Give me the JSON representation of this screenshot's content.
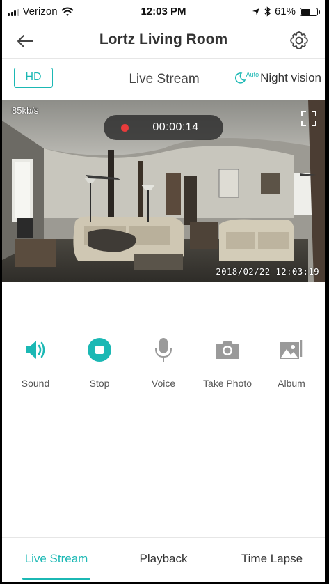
{
  "status_bar": {
    "carrier": "Verizon",
    "time": "12:03 PM",
    "battery": "61%",
    "battery_level": 0.61
  },
  "header": {
    "title": "Lortz Living Room",
    "back_icon": "arrow-left-icon",
    "settings_icon": "gear-icon"
  },
  "stream_bar": {
    "quality": "HD",
    "mode_label": "Live Stream",
    "night_auto": "Auto",
    "night_label": "Night vision"
  },
  "video": {
    "bitrate": "85kb/s",
    "recording_time": "00:00:14",
    "timestamp": "2018/02/22  12:03:19"
  },
  "controls": [
    {
      "label": "Sound",
      "icon": "speaker-icon",
      "active": true
    },
    {
      "label": "Stop",
      "icon": "stop-icon",
      "active": true
    },
    {
      "label": "Voice",
      "icon": "microphone-icon",
      "active": false
    },
    {
      "label": "Take Photo",
      "icon": "camera-icon",
      "active": false
    },
    {
      "label": "Album",
      "icon": "album-icon",
      "active": false
    }
  ],
  "tabs": [
    {
      "label": "Live Stream",
      "active": true
    },
    {
      "label": "Playback",
      "active": false
    },
    {
      "label": "Time Lapse",
      "active": false
    }
  ],
  "colors": {
    "accent": "#1bb8b4",
    "recording_dot": "#e83b3b",
    "inactive_icon": "#9a9a9a"
  }
}
